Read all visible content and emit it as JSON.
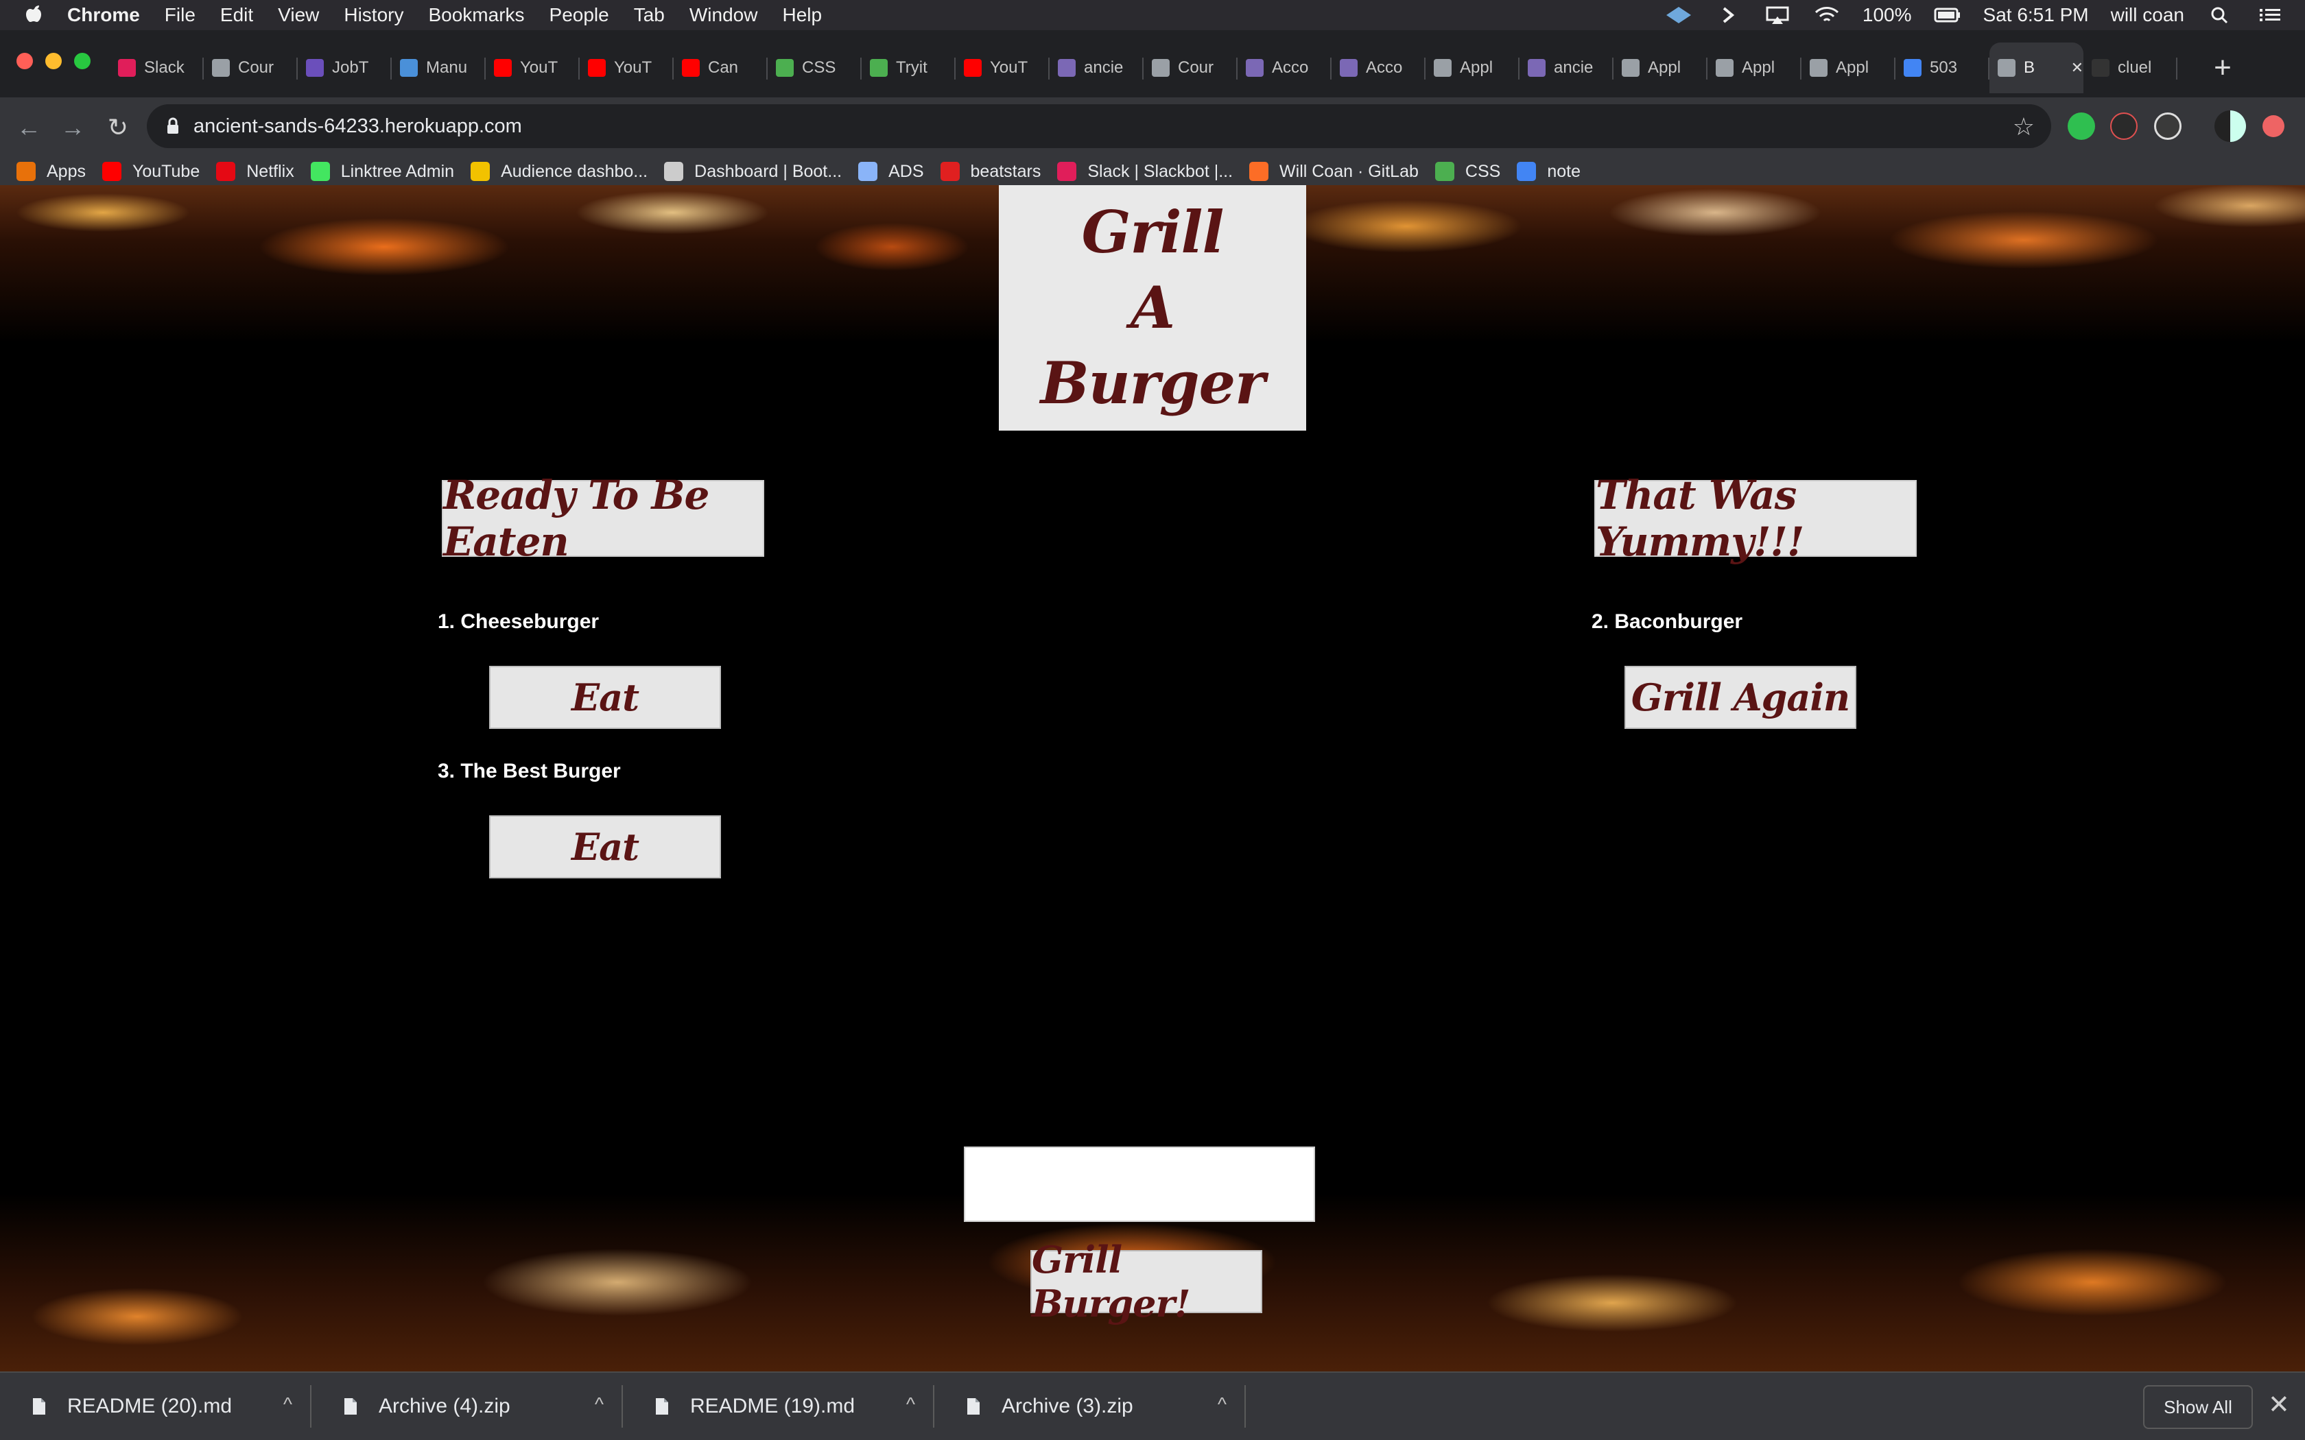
{
  "menubar": {
    "apple": "",
    "app": "Chrome",
    "items": [
      "File",
      "Edit",
      "View",
      "History",
      "Bookmarks",
      "People",
      "Tab",
      "Window",
      "Help"
    ],
    "battery": "100%",
    "clock": "Sat 6:51 PM",
    "user": "will coan"
  },
  "tabs": [
    {
      "label": "Slack",
      "icon": "slack-icon",
      "color": "#e01e5a"
    },
    {
      "label": "Cour",
      "icon": "globe-icon",
      "color": "#9aa0a6"
    },
    {
      "label": "JobT",
      "icon": "check-icon",
      "color": "#6b4fbb"
    },
    {
      "label": "Manu",
      "icon": "cube-icon",
      "color": "#4a90d9"
    },
    {
      "label": "YouT",
      "icon": "youtube-icon",
      "color": "#ff0000"
    },
    {
      "label": "YouT",
      "icon": "youtube-icon",
      "color": "#ff0000"
    },
    {
      "label": "Can",
      "icon": "youtube-icon",
      "color": "#ff0000"
    },
    {
      "label": "CSS",
      "icon": "w3-icon",
      "color": "#4caf50"
    },
    {
      "label": "Tryit",
      "icon": "w3-icon",
      "color": "#4caf50"
    },
    {
      "label": "YouT",
      "icon": "youtube-icon",
      "color": "#ff0000"
    },
    {
      "label": "ancie",
      "icon": "heroku-icon",
      "color": "#7b68b5"
    },
    {
      "label": "Cour",
      "icon": "globe-icon",
      "color": "#9aa0a6"
    },
    {
      "label": "Acco",
      "icon": "heroku-icon",
      "color": "#7b68b5"
    },
    {
      "label": "Acco",
      "icon": "heroku-icon",
      "color": "#7b68b5"
    },
    {
      "label": "Appl",
      "icon": "globe-icon",
      "color": "#9aa0a6"
    },
    {
      "label": "ancie",
      "icon": "heroku-icon",
      "color": "#7b68b5"
    },
    {
      "label": "Appl",
      "icon": "globe-icon",
      "color": "#9aa0a6"
    },
    {
      "label": "Appl",
      "icon": "globe-icon",
      "color": "#9aa0a6"
    },
    {
      "label": "Appl",
      "icon": "globe-icon",
      "color": "#9aa0a6"
    },
    {
      "label": "503",
      "icon": "google-icon",
      "color": "#4285f4"
    },
    {
      "label": "B",
      "icon": "globe-icon",
      "color": "#9aa0a6",
      "active": true
    },
    {
      "label": "cluel",
      "icon": "github-icon",
      "color": "#333333"
    }
  ],
  "toolbar": {
    "url": "ancient-sands-64233.herokuapp.com",
    "newtab": "+",
    "back": "←",
    "forward": "→",
    "reload": "↻",
    "star": "☆"
  },
  "bookmarks": [
    {
      "label": "Apps",
      "icon": "apps-grid-icon",
      "color": "#e8710a"
    },
    {
      "label": "YouTube",
      "icon": "youtube-icon",
      "color": "#ff0000"
    },
    {
      "label": "Netflix",
      "icon": "netflix-icon",
      "color": "#e50914"
    },
    {
      "label": "Linktree Admin",
      "icon": "linktree-icon",
      "color": "#43e660"
    },
    {
      "label": "Audience dashbo...",
      "icon": "audience-icon",
      "color": "#f2c200"
    },
    {
      "label": "Dashboard | Boot...",
      "icon": "globe-icon",
      "color": "#cccccc"
    },
    {
      "label": "ADS",
      "icon": "folder-icon",
      "color": "#8ab4f8"
    },
    {
      "label": "beatstars",
      "icon": "beatstars-icon",
      "color": "#e02020"
    },
    {
      "label": "Slack | Slackbot |...",
      "icon": "slack-icon",
      "color": "#e01e5a"
    },
    {
      "label": "Will Coan · GitLab",
      "icon": "gitlab-icon",
      "color": "#fc6d26"
    },
    {
      "label": "CSS",
      "icon": "w3-icon",
      "color": "#4caf50"
    },
    {
      "label": "note",
      "icon": "google-icon",
      "color": "#4285f4"
    }
  ],
  "page": {
    "logo": [
      "Grill",
      "A",
      "Burger"
    ],
    "ready_heading": "Ready To Be Eaten",
    "eaten_heading": "That Was Yummy!!!",
    "ready_items": [
      {
        "label": "1. Cheeseburger",
        "button": "Eat"
      },
      {
        "label": "3. The Best Burger",
        "button": "Eat"
      }
    ],
    "eaten_items": [
      {
        "label": "2. Baconburger",
        "button": "Grill Again"
      }
    ],
    "burger_input": {
      "value": "",
      "placeholder": ""
    },
    "grill_button": "Grill Burger!"
  },
  "downloads": [
    {
      "name": "README (20).md",
      "icon": "document-icon"
    },
    {
      "name": "Archive (4).zip",
      "icon": "document-icon"
    },
    {
      "name": "README (19).md",
      "icon": "document-icon"
    },
    {
      "name": "Archive (3).zip",
      "icon": "document-icon"
    }
  ],
  "shelf": {
    "show_all": "Show All",
    "close": "✕",
    "chevron": "^"
  }
}
